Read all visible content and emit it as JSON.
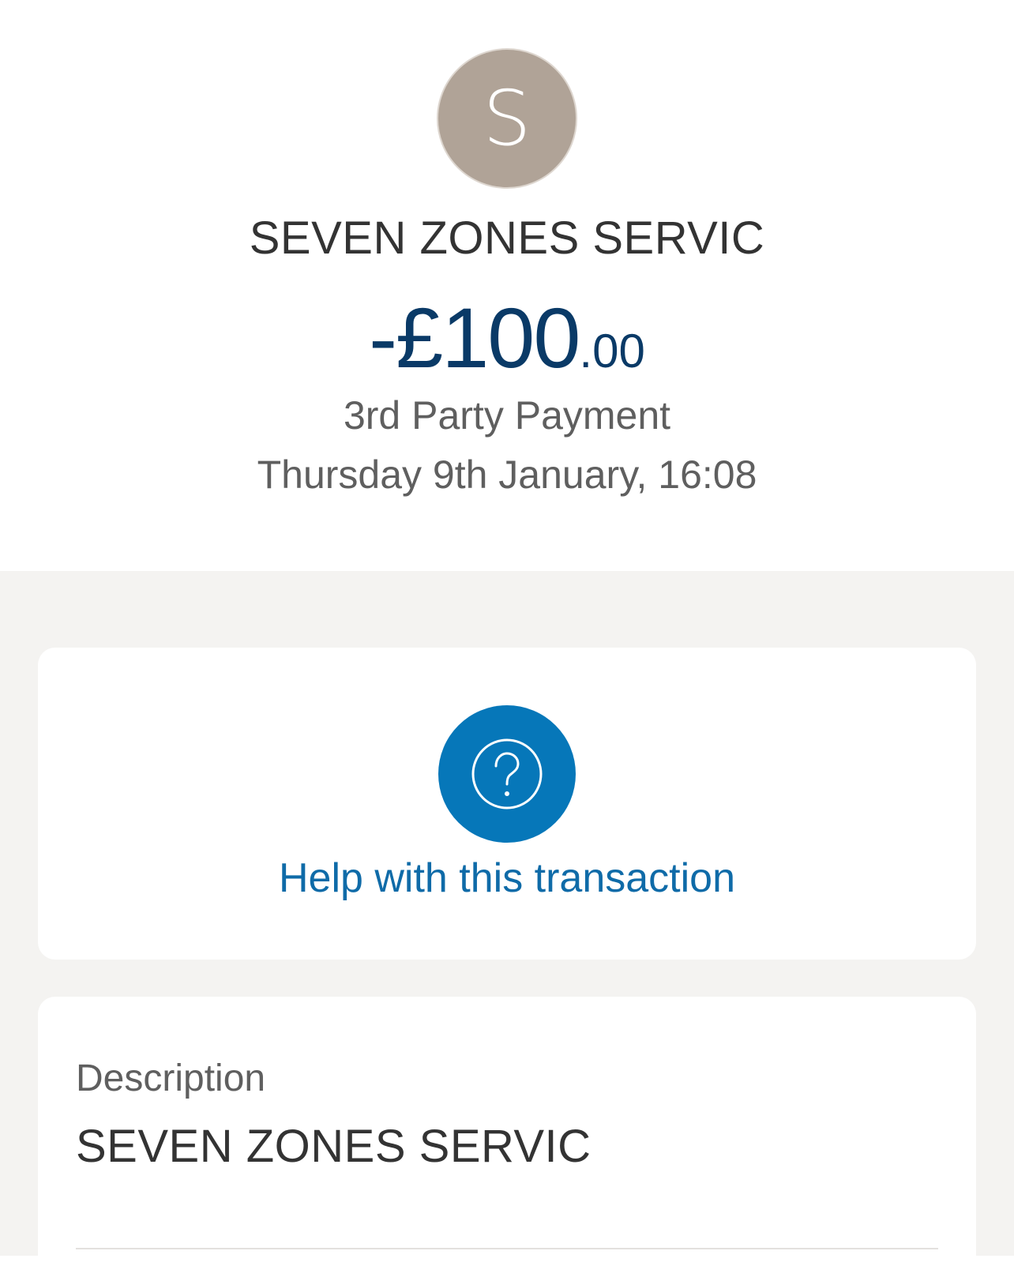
{
  "transaction": {
    "avatar_initial": "S",
    "merchant": "SEVEN ZONES SERVIC",
    "amount_major": "-£100",
    "amount_minor": ".00",
    "type": "3rd Party Payment",
    "datetime": "Thursday 9th January, 16:08"
  },
  "help": {
    "icon": "question-circle-icon",
    "label": "Help with this transaction"
  },
  "details": {
    "description_label": "Description",
    "description_value": "SEVEN ZONES SERVIC"
  },
  "colors": {
    "avatar_bg": "#b0a397",
    "amount": "#0a3a67",
    "help_circle": "#0677b9",
    "help_link": "#0f6ba8",
    "page_bg": "#f4f3f1"
  }
}
